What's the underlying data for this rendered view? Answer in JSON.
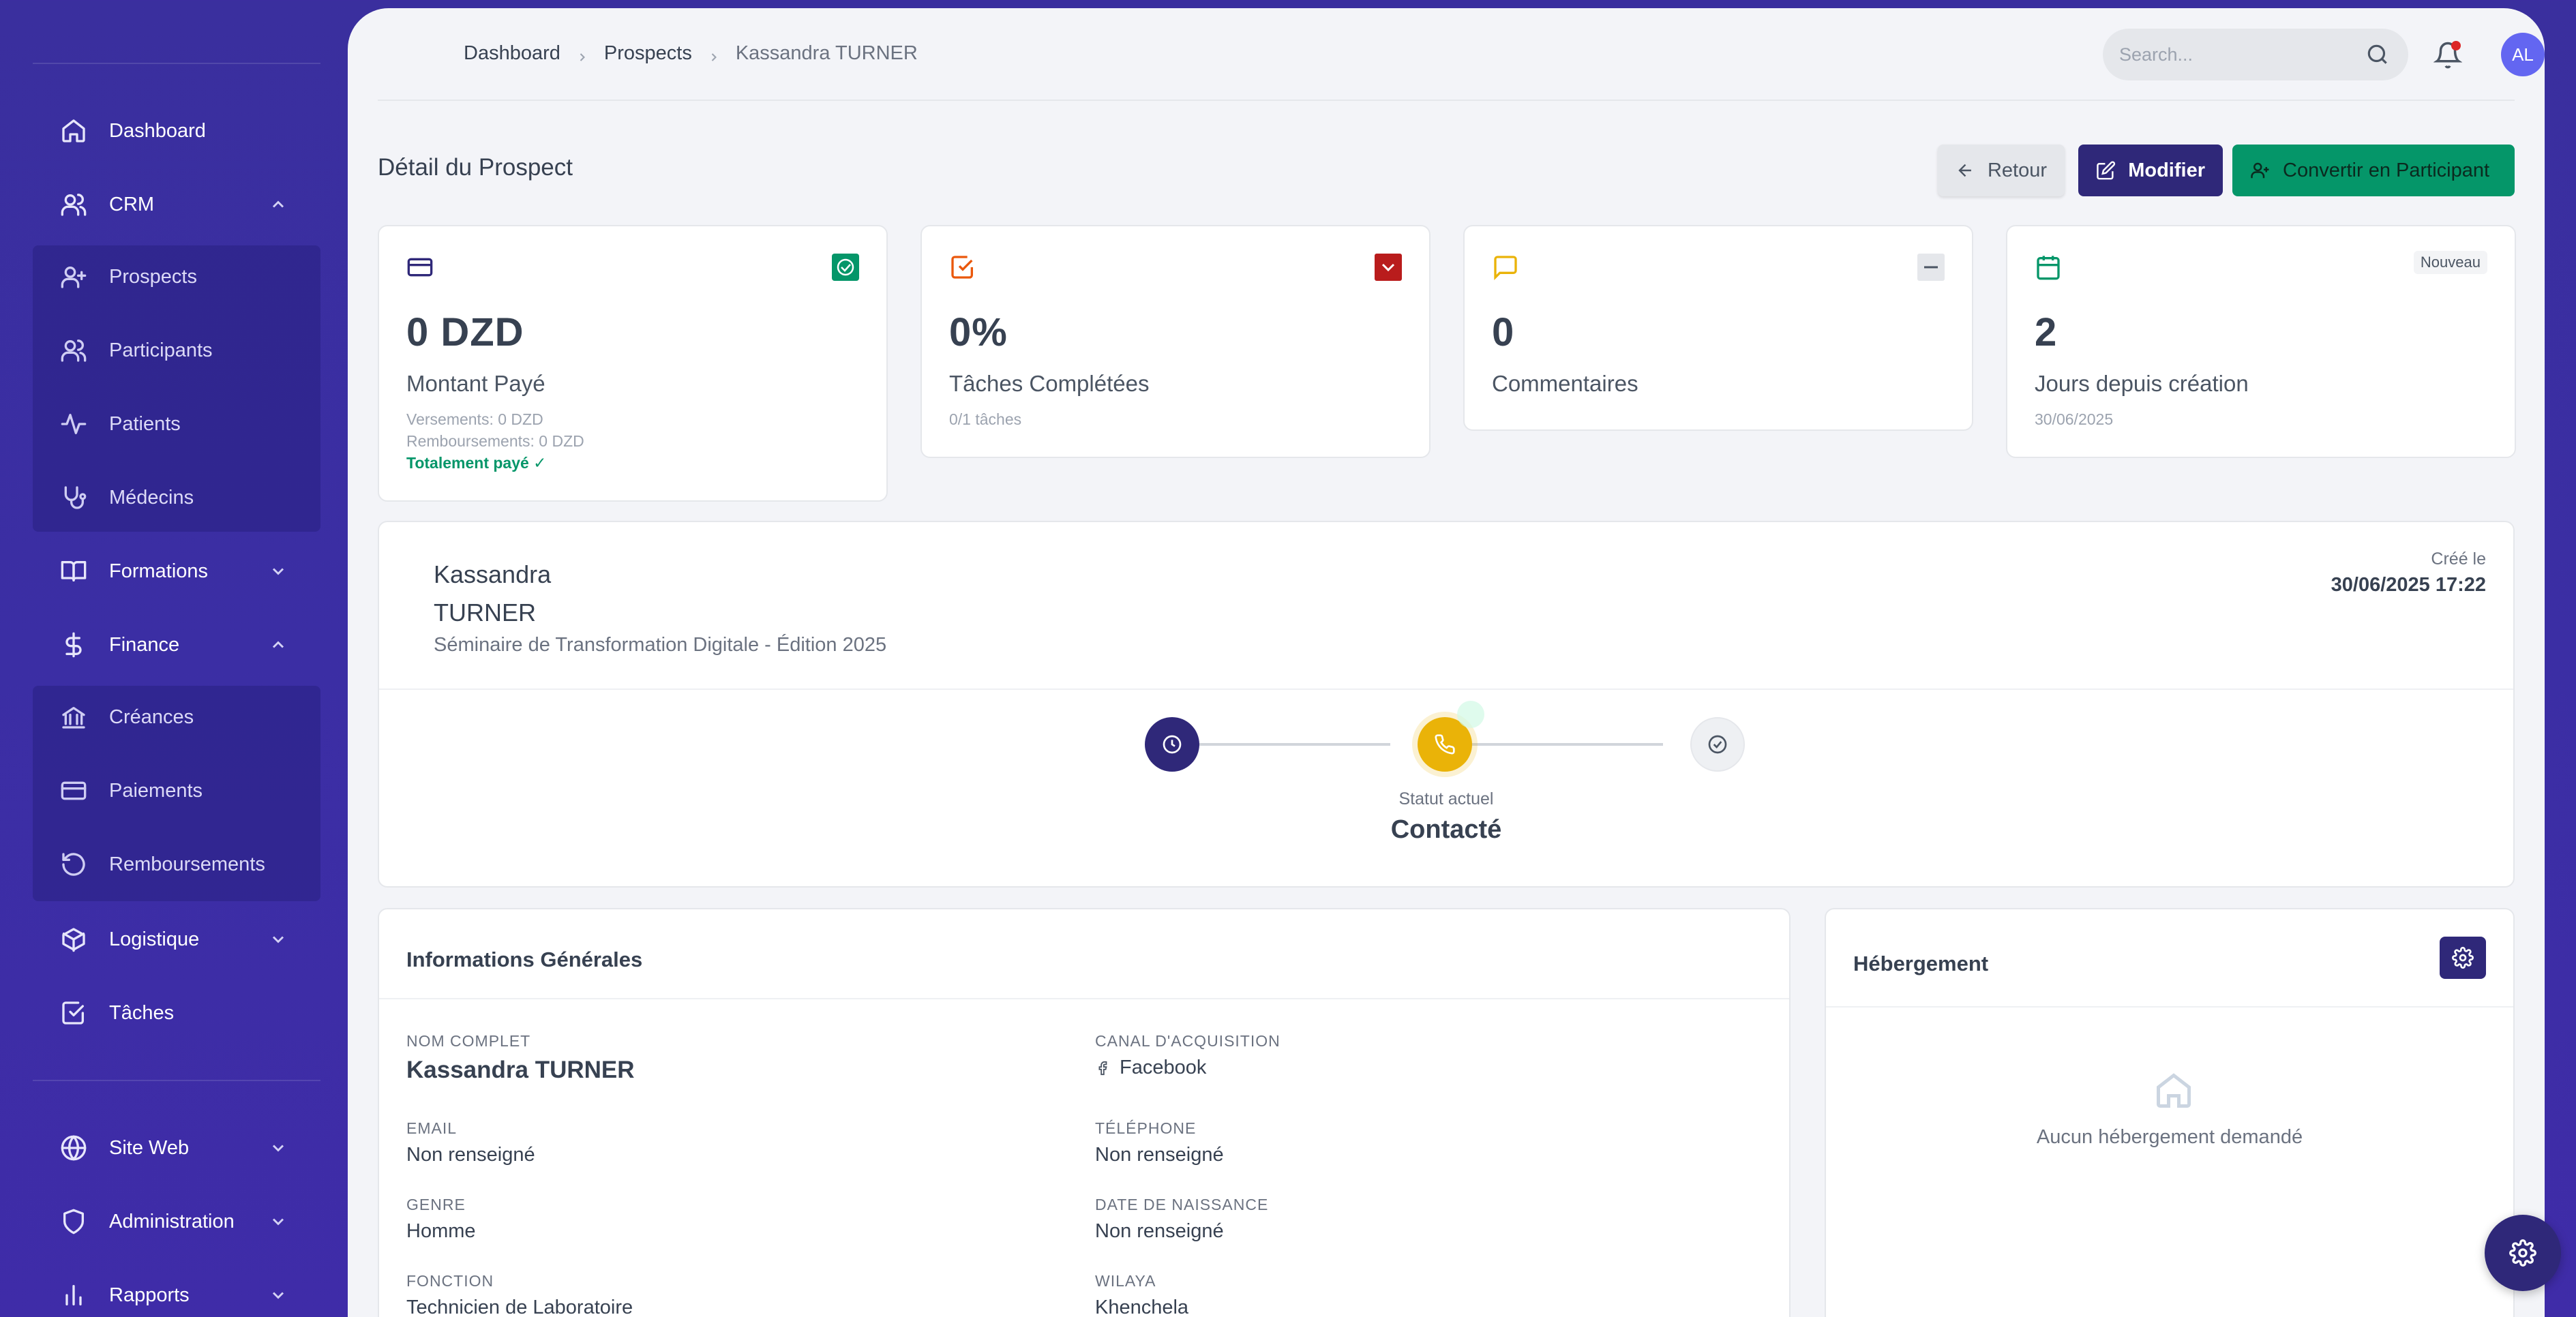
{
  "sidebar": {
    "items": [
      {
        "label": "Dashboard",
        "icon": "home-icon"
      },
      {
        "label": "CRM",
        "icon": "users-icon"
      },
      {
        "label": "Prospects",
        "icon": "user-plus-icon"
      },
      {
        "label": "Participants",
        "icon": "users-icon"
      },
      {
        "label": "Patients",
        "icon": "activity-icon"
      },
      {
        "label": "Médecins",
        "icon": "stethoscope-icon"
      },
      {
        "label": "Formations",
        "icon": "book-icon"
      },
      {
        "label": "Finance",
        "icon": "dollar-icon"
      },
      {
        "label": "Créances",
        "icon": "bank-icon"
      },
      {
        "label": "Paiements",
        "icon": "credit-card-icon"
      },
      {
        "label": "Remboursements",
        "icon": "refund-icon"
      },
      {
        "label": "Logistique",
        "icon": "package-icon"
      },
      {
        "label": "Tâches",
        "icon": "checkbox-icon"
      },
      {
        "label": "Site Web",
        "icon": "globe-icon"
      },
      {
        "label": "Administration",
        "icon": "shield-icon"
      },
      {
        "label": "Rapports",
        "icon": "bar-chart-icon"
      }
    ]
  },
  "header": {
    "breadcrumb": [
      "Dashboard",
      "Prospects",
      "Kassandra TURNER"
    ],
    "search_placeholder": "Search...",
    "avatar_initials": "AL"
  },
  "page": {
    "title": "Détail du Prospect",
    "buttons": {
      "back": "Retour",
      "edit": "Modifier",
      "convert": "Convertir en Participant"
    }
  },
  "stats": {
    "paid": {
      "value": "0 DZD",
      "label": "Montant Payé",
      "versements": "Versements: 0 DZD",
      "remboursements": "Remboursements: 0 DZD",
      "status": "Totalement payé ✓"
    },
    "tasks": {
      "value": "0%",
      "label": "Tâches Complétées",
      "sub": "0/1 tâches"
    },
    "comments": {
      "value": "0",
      "label": "Commentaires"
    },
    "days": {
      "value": "2",
      "label": "Jours depuis création",
      "sub": "30/06/2025",
      "badge": "Nouveau"
    }
  },
  "profile": {
    "first_name": "Kassandra",
    "last_name": "TURNER",
    "event": "Séminaire de Transformation Digitale - Édition 2025",
    "created_label": "Créé le",
    "created_date": "30/06/2025 17:22",
    "status_label": "Statut actuel",
    "status_value": "Contacté"
  },
  "info": {
    "title": "Informations Générales",
    "fields": {
      "full_name": {
        "label": "NOM COMPLET",
        "value": "Kassandra TURNER"
      },
      "channel": {
        "label": "CANAL D'ACQUISITION",
        "value": "Facebook"
      },
      "email": {
        "label": "EMAIL",
        "value": "Non renseigné"
      },
      "phone": {
        "label": "TÉLÉPHONE",
        "value": "Non renseigné"
      },
      "gender": {
        "label": "GENRE",
        "value": "Homme"
      },
      "birthdate": {
        "label": "DATE DE NAISSANCE",
        "value": "Non renseigné"
      },
      "job": {
        "label": "FONCTION",
        "value": "Technicien de Laboratoire"
      },
      "wilaya": {
        "label": "WILAYA",
        "value": "Khenchela"
      }
    }
  },
  "hebergement": {
    "title": "Hébergement",
    "empty": "Aucun hébergement demandé"
  },
  "colors": {
    "sidebar_bg": "#3a2f9e",
    "primary": "#2f2879",
    "success": "#059669",
    "warning": "#eab308",
    "danger": "#b91c1c"
  }
}
